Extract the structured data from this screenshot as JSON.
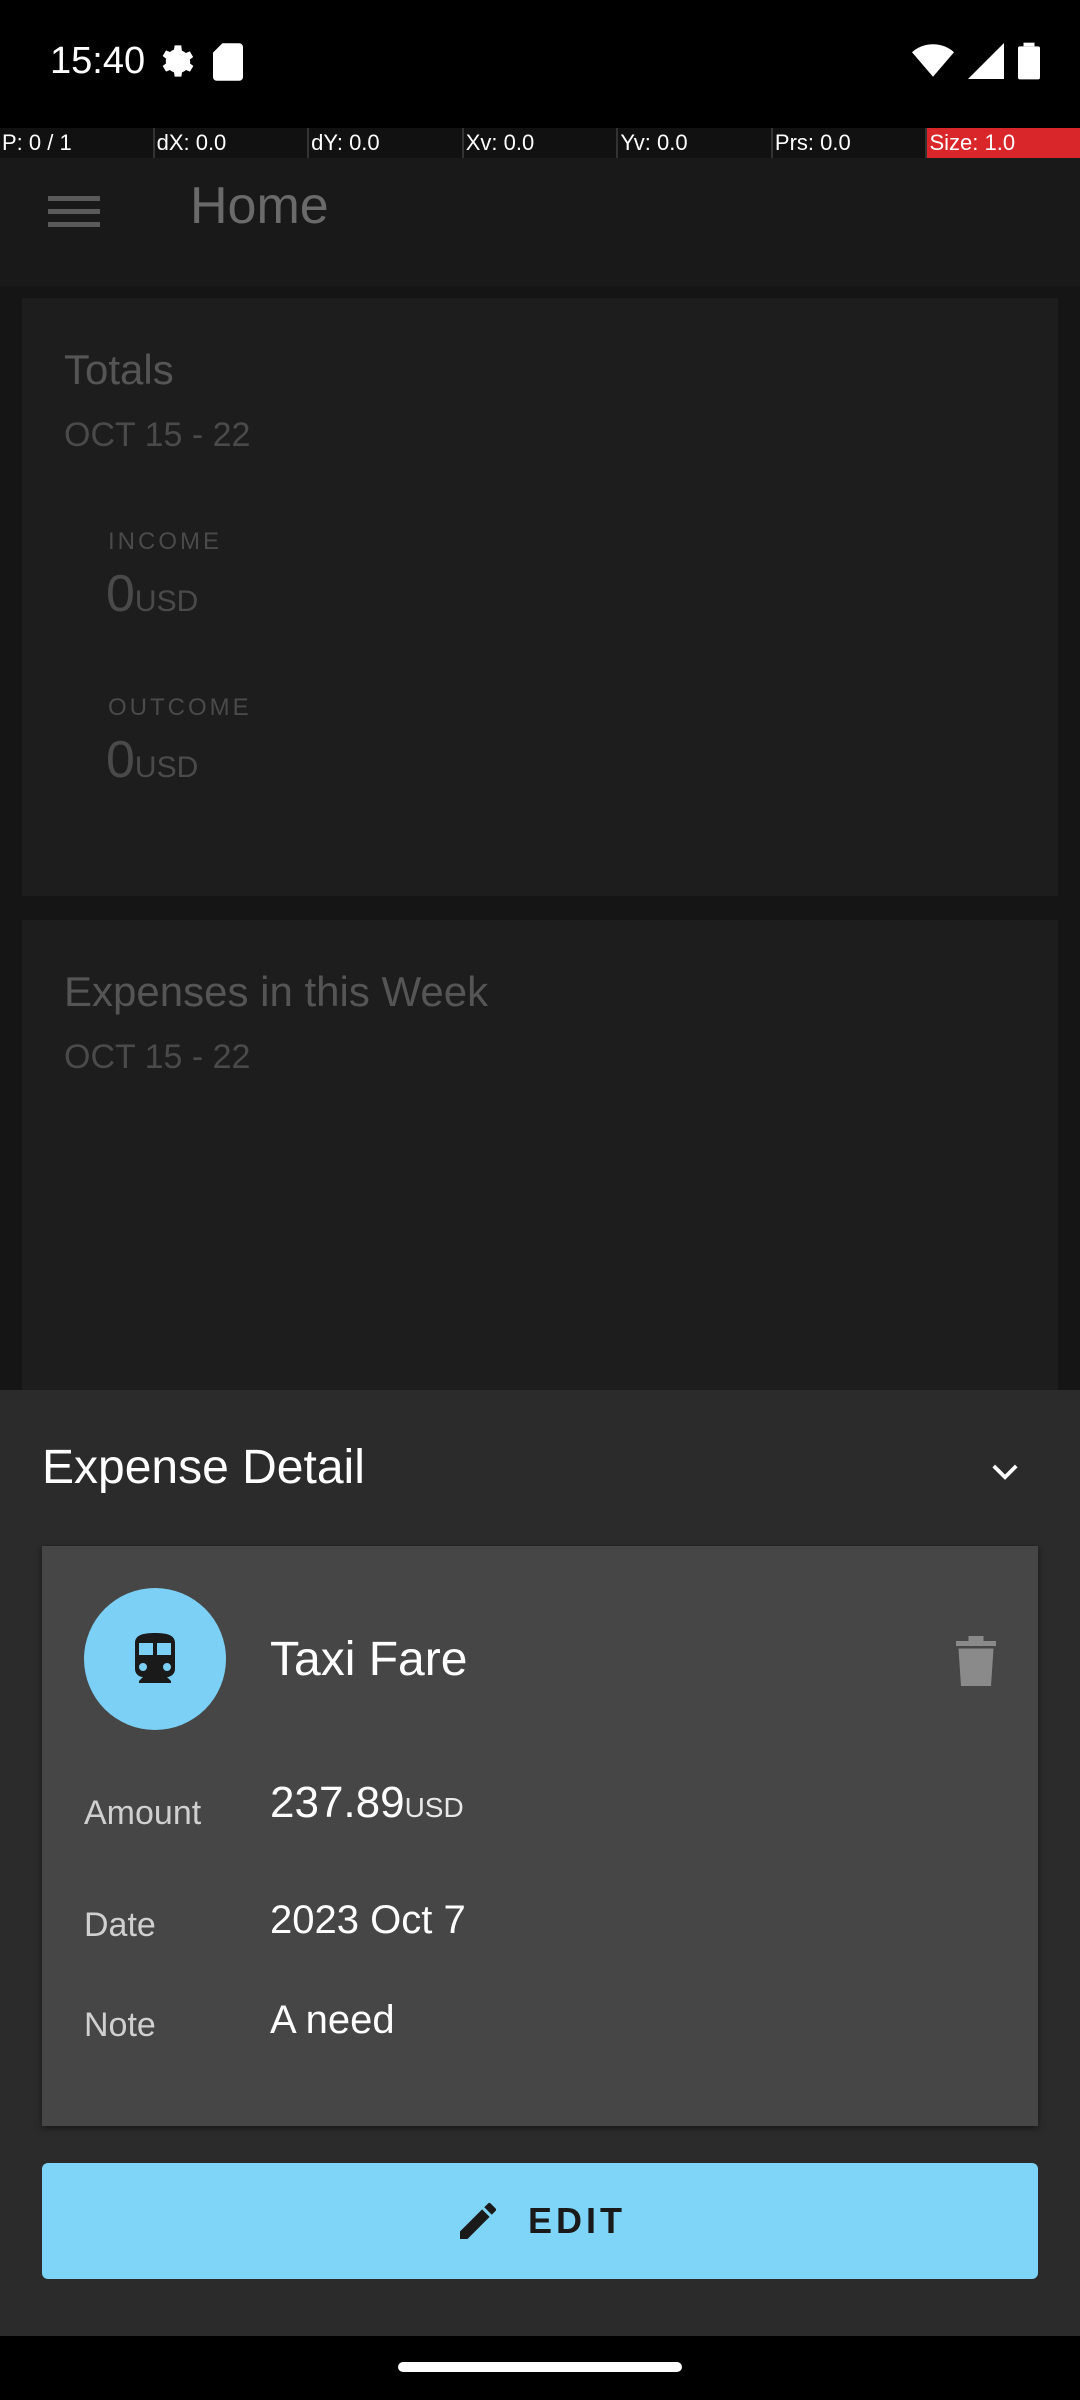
{
  "status": {
    "time": "15:40"
  },
  "debug": {
    "cells": [
      "P: 0 / 1",
      "dX: 0.0",
      "dY: 0.0",
      "Xv: 0.0",
      "Yv: 0.0",
      "Prs: 0.0",
      "Size: 1.0"
    ]
  },
  "app": {
    "title": "Home",
    "totals": {
      "title": "Totals",
      "range": "OCT 15 - 22",
      "income_label": "INCOME",
      "income_value": "0",
      "income_currency": "USD",
      "outcome_label": "OUTCOME",
      "outcome_value": "0",
      "outcome_currency": "USD"
    },
    "weekly": {
      "title": "Expenses in this Week",
      "range": "OCT 15 - 22"
    }
  },
  "sheet": {
    "title": "Expense Detail",
    "expense": {
      "name": "Taxi Fare",
      "category_icon": "train-icon",
      "amount_label": "Amount",
      "amount_value": "237.89",
      "amount_currency": "USD",
      "date_label": "Date",
      "date_value": "2023 Oct 7",
      "note_label": "Note",
      "note_value": "A need"
    },
    "edit_label": "EDIT"
  },
  "colors": {
    "accent": "#7fd5f7",
    "sheet_bg": "#2b2b2b",
    "card_bg": "#464646",
    "debug_highlight": "#d9262a"
  }
}
